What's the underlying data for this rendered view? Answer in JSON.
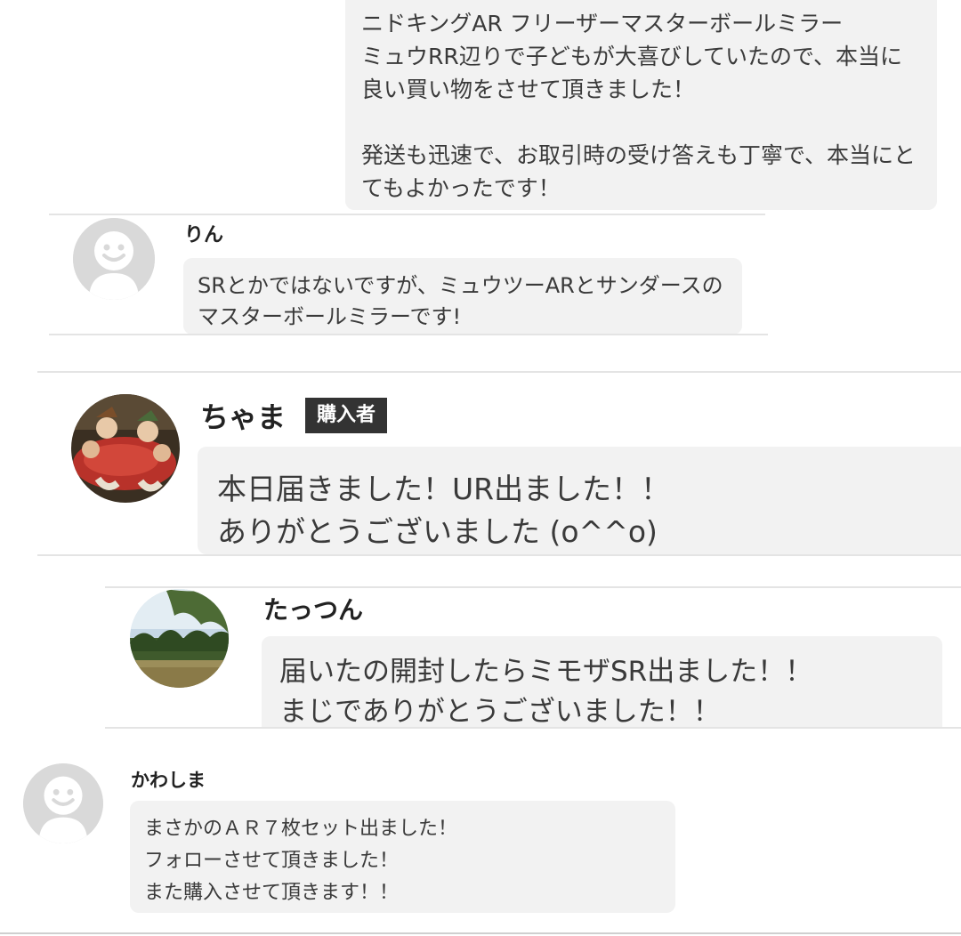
{
  "reviews": [
    {
      "name": "",
      "comment": "ニドキングAR フリーザーマスターボールミラー\nミュウRR辺りで子どもが大喜びしていたので、本当に良い買い物をさせて頂きました！\n\n発送も迅速で、お取引時の受け答えも丁寧で、本当にとてもよかったです！"
    },
    {
      "name": "りん",
      "avatar_icon": "default-user-icon",
      "comment": "SRとかではないですが、ミュウツーARとサンダースのマスターボールミラーです!"
    },
    {
      "name": "ちゃま",
      "badge": "購入者",
      "avatar_icon": "illustration-avatar",
      "comment": "本日届きました！UR出ました！！\nありがとうございました (o^^o)"
    },
    {
      "name": "たっつん",
      "avatar_icon": "landscape-photo-avatar",
      "comment": "届いたの開封したらミモザSR出ました！！\nまじでありがとうございました！！"
    },
    {
      "name": "かわしま",
      "avatar_icon": "default-user-icon",
      "comment": "まさかのＡＲ７枚セット出ました！\nフォローさせて頂きました！\nまた購入させて頂きます！！"
    }
  ],
  "colors": {
    "bubble": "#f2f2f2",
    "badge_bg": "#333333",
    "avatar_placeholder": "#d9d9d9"
  }
}
